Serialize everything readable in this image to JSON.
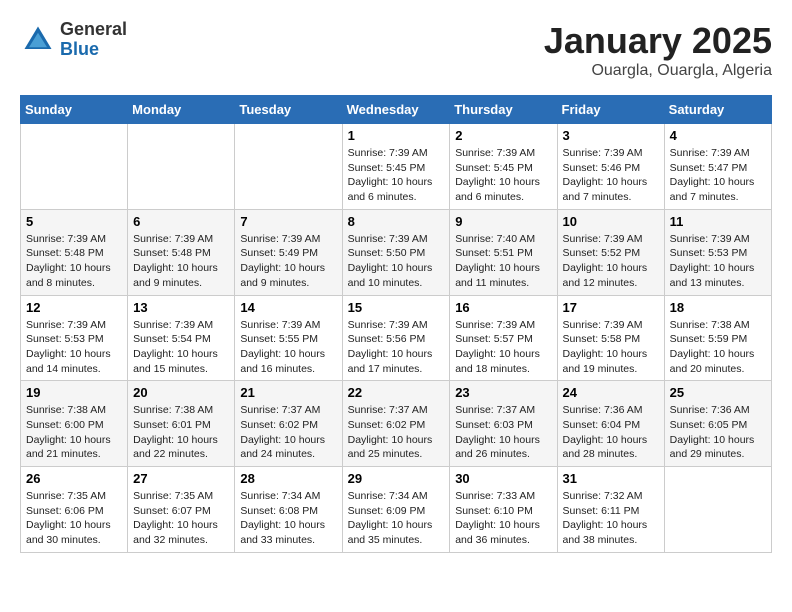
{
  "header": {
    "logo_general": "General",
    "logo_blue": "Blue",
    "month": "January 2025",
    "location": "Ouargla, Ouargla, Algeria"
  },
  "days_of_week": [
    "Sunday",
    "Monday",
    "Tuesday",
    "Wednesday",
    "Thursday",
    "Friday",
    "Saturday"
  ],
  "weeks": [
    [
      {
        "day": "",
        "info": ""
      },
      {
        "day": "",
        "info": ""
      },
      {
        "day": "",
        "info": ""
      },
      {
        "day": "1",
        "info": "Sunrise: 7:39 AM\nSunset: 5:45 PM\nDaylight: 10 hours\nand 6 minutes."
      },
      {
        "day": "2",
        "info": "Sunrise: 7:39 AM\nSunset: 5:45 PM\nDaylight: 10 hours\nand 6 minutes."
      },
      {
        "day": "3",
        "info": "Sunrise: 7:39 AM\nSunset: 5:46 PM\nDaylight: 10 hours\nand 7 minutes."
      },
      {
        "day": "4",
        "info": "Sunrise: 7:39 AM\nSunset: 5:47 PM\nDaylight: 10 hours\nand 7 minutes."
      }
    ],
    [
      {
        "day": "5",
        "info": "Sunrise: 7:39 AM\nSunset: 5:48 PM\nDaylight: 10 hours\nand 8 minutes."
      },
      {
        "day": "6",
        "info": "Sunrise: 7:39 AM\nSunset: 5:48 PM\nDaylight: 10 hours\nand 9 minutes."
      },
      {
        "day": "7",
        "info": "Sunrise: 7:39 AM\nSunset: 5:49 PM\nDaylight: 10 hours\nand 9 minutes."
      },
      {
        "day": "8",
        "info": "Sunrise: 7:39 AM\nSunset: 5:50 PM\nDaylight: 10 hours\nand 10 minutes."
      },
      {
        "day": "9",
        "info": "Sunrise: 7:40 AM\nSunset: 5:51 PM\nDaylight: 10 hours\nand 11 minutes."
      },
      {
        "day": "10",
        "info": "Sunrise: 7:39 AM\nSunset: 5:52 PM\nDaylight: 10 hours\nand 12 minutes."
      },
      {
        "day": "11",
        "info": "Sunrise: 7:39 AM\nSunset: 5:53 PM\nDaylight: 10 hours\nand 13 minutes."
      }
    ],
    [
      {
        "day": "12",
        "info": "Sunrise: 7:39 AM\nSunset: 5:53 PM\nDaylight: 10 hours\nand 14 minutes."
      },
      {
        "day": "13",
        "info": "Sunrise: 7:39 AM\nSunset: 5:54 PM\nDaylight: 10 hours\nand 15 minutes."
      },
      {
        "day": "14",
        "info": "Sunrise: 7:39 AM\nSunset: 5:55 PM\nDaylight: 10 hours\nand 16 minutes."
      },
      {
        "day": "15",
        "info": "Sunrise: 7:39 AM\nSunset: 5:56 PM\nDaylight: 10 hours\nand 17 minutes."
      },
      {
        "day": "16",
        "info": "Sunrise: 7:39 AM\nSunset: 5:57 PM\nDaylight: 10 hours\nand 18 minutes."
      },
      {
        "day": "17",
        "info": "Sunrise: 7:39 AM\nSunset: 5:58 PM\nDaylight: 10 hours\nand 19 minutes."
      },
      {
        "day": "18",
        "info": "Sunrise: 7:38 AM\nSunset: 5:59 PM\nDaylight: 10 hours\nand 20 minutes."
      }
    ],
    [
      {
        "day": "19",
        "info": "Sunrise: 7:38 AM\nSunset: 6:00 PM\nDaylight: 10 hours\nand 21 minutes."
      },
      {
        "day": "20",
        "info": "Sunrise: 7:38 AM\nSunset: 6:01 PM\nDaylight: 10 hours\nand 22 minutes."
      },
      {
        "day": "21",
        "info": "Sunrise: 7:37 AM\nSunset: 6:02 PM\nDaylight: 10 hours\nand 24 minutes."
      },
      {
        "day": "22",
        "info": "Sunrise: 7:37 AM\nSunset: 6:02 PM\nDaylight: 10 hours\nand 25 minutes."
      },
      {
        "day": "23",
        "info": "Sunrise: 7:37 AM\nSunset: 6:03 PM\nDaylight: 10 hours\nand 26 minutes."
      },
      {
        "day": "24",
        "info": "Sunrise: 7:36 AM\nSunset: 6:04 PM\nDaylight: 10 hours\nand 28 minutes."
      },
      {
        "day": "25",
        "info": "Sunrise: 7:36 AM\nSunset: 6:05 PM\nDaylight: 10 hours\nand 29 minutes."
      }
    ],
    [
      {
        "day": "26",
        "info": "Sunrise: 7:35 AM\nSunset: 6:06 PM\nDaylight: 10 hours\nand 30 minutes."
      },
      {
        "day": "27",
        "info": "Sunrise: 7:35 AM\nSunset: 6:07 PM\nDaylight: 10 hours\nand 32 minutes."
      },
      {
        "day": "28",
        "info": "Sunrise: 7:34 AM\nSunset: 6:08 PM\nDaylight: 10 hours\nand 33 minutes."
      },
      {
        "day": "29",
        "info": "Sunrise: 7:34 AM\nSunset: 6:09 PM\nDaylight: 10 hours\nand 35 minutes."
      },
      {
        "day": "30",
        "info": "Sunrise: 7:33 AM\nSunset: 6:10 PM\nDaylight: 10 hours\nand 36 minutes."
      },
      {
        "day": "31",
        "info": "Sunrise: 7:32 AM\nSunset: 6:11 PM\nDaylight: 10 hours\nand 38 minutes."
      },
      {
        "day": "",
        "info": ""
      }
    ]
  ]
}
